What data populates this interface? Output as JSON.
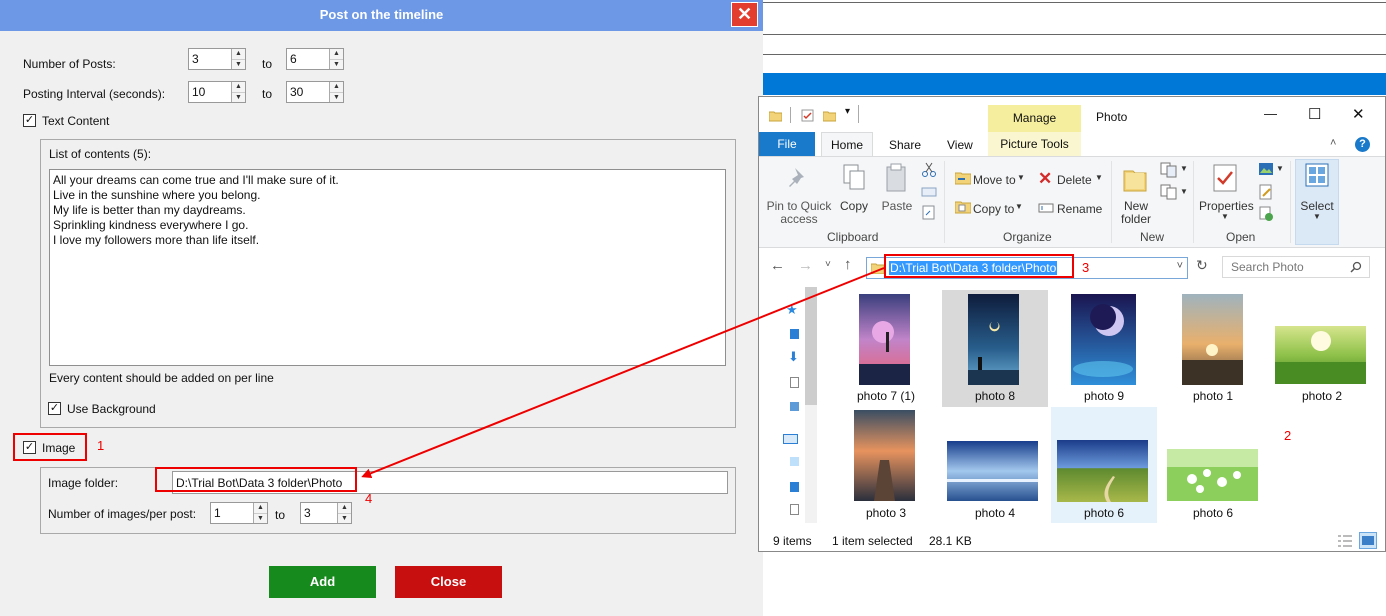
{
  "dialog": {
    "title": "Post on the timeline",
    "close_glyph": "✕",
    "posts_label": "Number of Posts:",
    "posts_from": "3",
    "posts_to": "6",
    "interval_label": "Posting Interval (seconds):",
    "interval_from": "10",
    "interval_to": "30",
    "to_label": "to",
    "text_content_label": "Text Content",
    "list_label": "List of contents (5):",
    "contents": [
      "All your dreams can come true and I'll make sure of it.",
      "Live in the sunshine where you belong.",
      "My life is better than my daydreams.",
      "Sprinkling kindness everywhere I go.",
      "I love my followers more than life itself."
    ],
    "per_line_note": "Every content should be added on per line",
    "use_background_label": "Use Background",
    "image_label": "Image",
    "image_folder_label": "Image folder:",
    "image_folder_value": "D:\\Trial Bot\\Data 3 folder\\Photo",
    "images_per_post_label": "Number of images/per post:",
    "images_from": "1",
    "images_to": "3",
    "add_button": "Add",
    "close_button": "Close",
    "colors": {
      "title_bar": "#6d98e6",
      "add": "#178a1e",
      "close": "#c80f10",
      "annotation": "#ee0000"
    }
  },
  "annotations": [
    "1",
    "2",
    "3",
    "4"
  ],
  "explorer": {
    "title": "Photo",
    "manage_tab": "Manage",
    "picture_tools_tab": "Picture Tools",
    "tabs": [
      "File",
      "Home",
      "Share",
      "View"
    ],
    "window_controls": [
      "—",
      "☐",
      "✕"
    ],
    "ribbon": {
      "pin_label_1": "Pin to Quick",
      "pin_label_2": "access",
      "copy": "Copy",
      "paste": "Paste",
      "clipboard_group": "Clipboard",
      "move_to": "Move to",
      "copy_to": "Copy to",
      "delete": "Delete",
      "rename": "Rename",
      "organize_group": "Organize",
      "new_folder_1": "New",
      "new_folder_2": "folder",
      "new_group": "New",
      "properties": "Properties",
      "open_group": "Open",
      "select": "Select"
    },
    "address": "D:\\Trial Bot\\Data 3 folder\\Photo",
    "search_placeholder": "Search Photo",
    "items": [
      {
        "name": "photo  7 (1)",
        "selected": false,
        "hover": false
      },
      {
        "name": "photo  8",
        "selected": false,
        "hover": true
      },
      {
        "name": "photo  9",
        "selected": false,
        "hover": false
      },
      {
        "name": "photo 1",
        "selected": false,
        "hover": false
      },
      {
        "name": "photo 2",
        "selected": false,
        "hover": false
      },
      {
        "name": "photo 3",
        "selected": false,
        "hover": false
      },
      {
        "name": "photo 4",
        "selected": false,
        "hover": false
      },
      {
        "name": "photo 6",
        "selected": true,
        "hover": false
      },
      {
        "name": "photo 6",
        "selected": false,
        "hover": false
      }
    ],
    "status_items": "9 items",
    "status_selected": "1 item selected",
    "status_size": "28.1 KB"
  }
}
